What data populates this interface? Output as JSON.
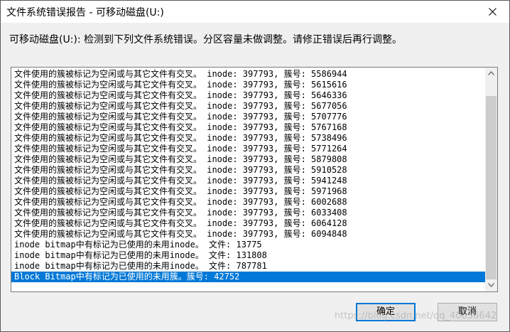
{
  "window": {
    "title": "文件系统错误报告 - 可移动磁盘(U:)"
  },
  "message": "可移动磁盘(U:): 检测到下列文件系统错误。分区容量未做调整。请修正错误后再行调整。",
  "list_items": [
    "文件使用的簇被标记为空闲或与其它文件有交叉。 inode: 397793, 簇号: 5586944",
    "文件使用的簇被标记为空闲或与其它文件有交叉。 inode: 397793, 簇号: 5615616",
    "文件使用的簇被标记为空闲或与其它文件有交叉。 inode: 397793, 簇号: 5646336",
    "文件使用的簇被标记为空闲或与其它文件有交叉。 inode: 397793, 簇号: 5677056",
    "文件使用的簇被标记为空闲或与其它文件有交叉。 inode: 397793, 簇号: 5707776",
    "文件使用的簇被标记为空闲或与其它文件有交叉。 inode: 397793, 簇号: 5767168",
    "文件使用的簇被标记为空闲或与其它文件有交叉。 inode: 397793, 簇号: 5738496",
    "文件使用的簇被标记为空闲或与其它文件有交叉。 inode: 397793, 簇号: 5771264",
    "文件使用的簇被标记为空闲或与其它文件有交叉。 inode: 397793, 簇号: 5879808",
    "文件使用的簇被标记为空闲或与其它文件有交叉。 inode: 397793, 簇号: 5910528",
    "文件使用的簇被标记为空闲或与其它文件有交叉。 inode: 397793, 簇号: 5941248",
    "文件使用的簇被标记为空闲或与其它文件有交叉。 inode: 397793, 簇号: 5971968",
    "文件使用的簇被标记为空闲或与其它文件有交叉。 inode: 397793, 簇号: 6002688",
    "文件使用的簇被标记为空闲或与其它文件有交叉。 inode: 397793, 簇号: 6033408",
    "文件使用的簇被标记为空闲或与其它文件有交叉。 inode: 397793, 簇号: 6064128",
    "文件使用的簇被标记为空闲或与其它文件有交叉。 inode: 397793, 簇号: 6094848",
    "inode bitmap中有标记为已使用的未用inode。 文件: 13775",
    "inode bitmap中有标记为已使用的未用inode。 文件: 131808",
    "inode bitmap中有标记为已使用的未用inode。 文件: 787781",
    "Block Bitmap中有标记为已使用的未用簇。簇号: 42752"
  ],
  "selected_index": 19,
  "buttons": {
    "ok": "确定",
    "cancel": "取消"
  },
  "watermark": "https://blog.csdn.net/qq_40036642",
  "colors": {
    "selection": "#0078d7",
    "default_button_border": "#0078d7"
  }
}
